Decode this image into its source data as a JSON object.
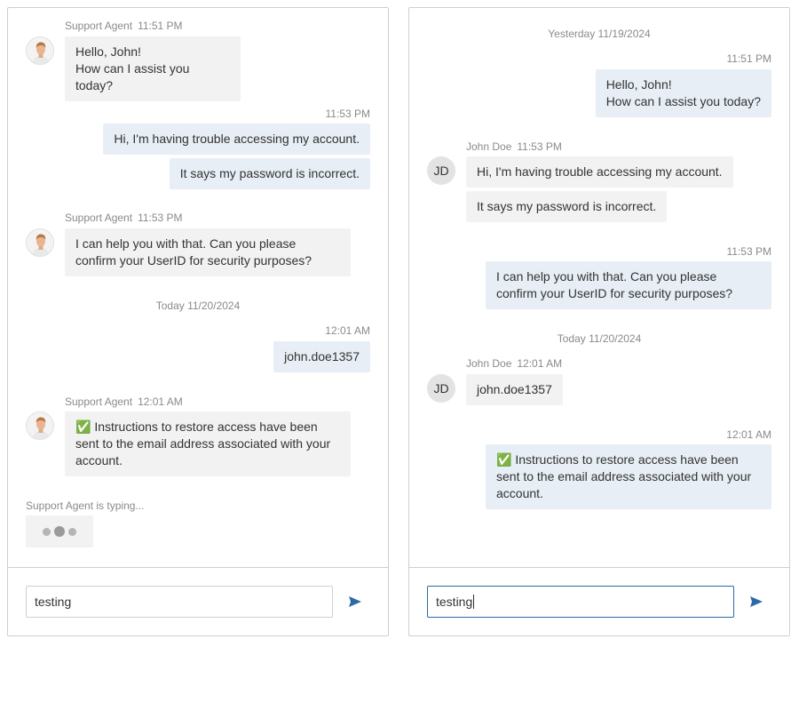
{
  "left_panel": {
    "messages": [
      {
        "sender": "Support Agent",
        "time": "11:51 PM",
        "lines": [
          "Hello, John!",
          "How can I assist you today?"
        ]
      },
      {
        "time": "11:53 PM",
        "bubbles": [
          "Hi, I'm having trouble accessing my account.",
          "It says my password is incorrect."
        ]
      },
      {
        "sender": "Support Agent",
        "time": "11:53 PM",
        "lines": [
          "I can help you with that. Can you please",
          "confirm your UserID for security purposes?"
        ]
      },
      {
        "separator": "Today 11/20/2024"
      },
      {
        "time": "12:01 AM",
        "bubbles": [
          "john.doe1357"
        ]
      },
      {
        "sender": "Support Agent",
        "time": "12:01 AM",
        "lines": [
          "✅ Instructions to restore access have been",
          "sent to the email address associated with your",
          "account."
        ]
      }
    ],
    "typing_text": "Support Agent is typing...",
    "input_value": "testing"
  },
  "right_panel": {
    "separator_top": "Yesterday 11/19/2024",
    "messages": [
      {
        "time": "11:51 PM",
        "lines": [
          "Hello, John!",
          "How can I assist you today?"
        ]
      },
      {
        "sender": "John Doe",
        "time": "11:53 PM",
        "initials": "JD",
        "bubbles": [
          "Hi, I'm having trouble accessing my account.",
          "It says my password is incorrect."
        ]
      },
      {
        "time": "11:53 PM",
        "lines": [
          "I can help you with that. Can you please",
          "confirm your UserID for security purposes?"
        ]
      },
      {
        "separator": "Today 11/20/2024"
      },
      {
        "sender": "John Doe",
        "time": "12:01 AM",
        "initials": "JD",
        "bubbles": [
          "john.doe1357"
        ]
      },
      {
        "time": "12:01 AM",
        "lines": [
          "✅ Instructions to restore access have been",
          "sent to the email address associated with your",
          "account."
        ]
      }
    ],
    "input_value": "testing"
  },
  "icons": {
    "send": "send-icon",
    "agent_avatar": "agent-avatar-icon"
  },
  "colors": {
    "accent": "#2a6aa6",
    "incoming_bubble": "#f2f2f2",
    "outgoing_bubble": "#e7eef5",
    "border": "#cfcfcf"
  }
}
